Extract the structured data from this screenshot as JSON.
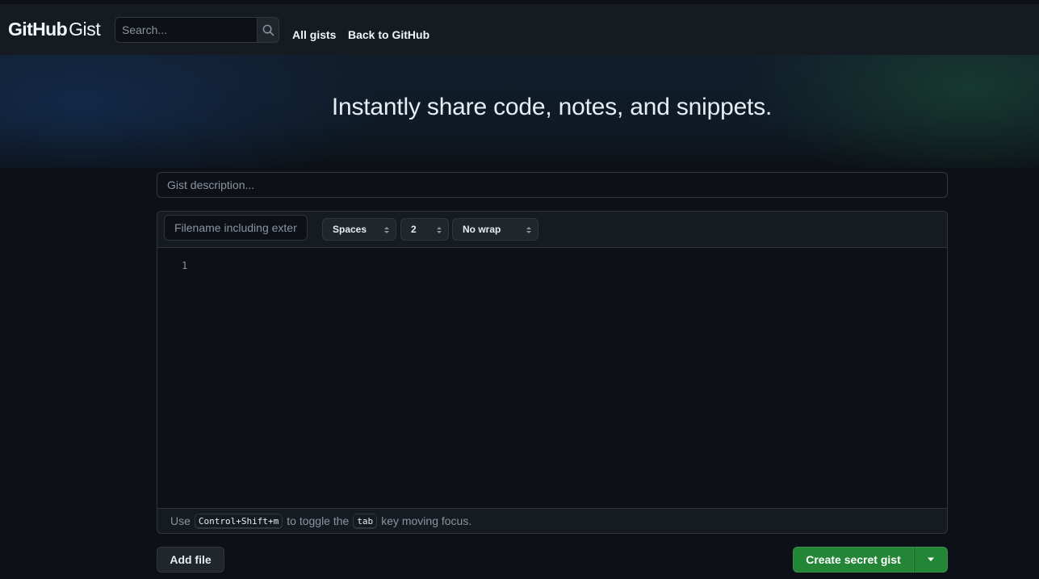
{
  "header": {
    "logo_primary": "GitHub",
    "logo_secondary": "Gist",
    "search_placeholder": "Search...",
    "search_icon": "search-icon",
    "nav": [
      "All gists",
      "Back to GitHub"
    ]
  },
  "hero": {
    "title": "Instantly share code, notes, and snippets."
  },
  "form": {
    "description_placeholder": "Gist description...",
    "filename_placeholder": "Filename including extension...",
    "indent_mode": "Spaces",
    "indent_size": "2",
    "wrap_mode": "No wrap",
    "line_numbers": [
      "1"
    ],
    "footer": {
      "prefix": "Use",
      "shortcut": "Control+Shift+m",
      "middle": "to toggle the",
      "key": "tab",
      "suffix": "key moving focus."
    },
    "add_file_label": "Add file",
    "create_label": "Create secret gist",
    "create_caret_icon": "triangle-down-icon"
  },
  "colors": {
    "background": "#0d1117",
    "header": "#161b22",
    "border": "#30363d",
    "primary_button": "#238636",
    "text": "#e6edf3",
    "muted": "#8b949e"
  }
}
